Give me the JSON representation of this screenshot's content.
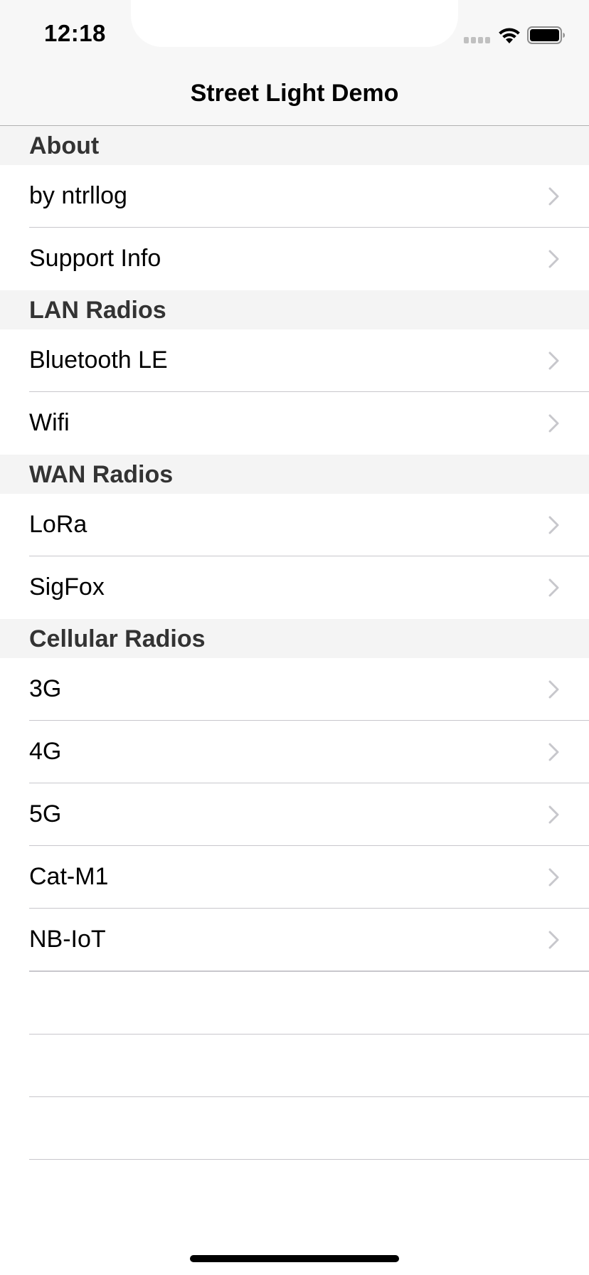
{
  "status_bar": {
    "time": "12:18"
  },
  "nav": {
    "title": "Street Light Demo"
  },
  "sections": [
    {
      "header": "About",
      "rows": [
        {
          "label": "by ntrllog"
        },
        {
          "label": "Support Info"
        }
      ]
    },
    {
      "header": "LAN Radios",
      "rows": [
        {
          "label": "Bluetooth LE"
        },
        {
          "label": "Wifi"
        }
      ]
    },
    {
      "header": "WAN Radios",
      "rows": [
        {
          "label": "LoRa"
        },
        {
          "label": "SigFox"
        }
      ]
    },
    {
      "header": "Cellular Radios",
      "rows": [
        {
          "label": "3G"
        },
        {
          "label": "4G"
        },
        {
          "label": "5G"
        },
        {
          "label": "Cat-M1"
        },
        {
          "label": "NB-IoT"
        }
      ]
    }
  ],
  "icons": {
    "row_accessory": "chevron-right-icon",
    "status": [
      "cellular-signal-icon",
      "wifi-icon",
      "battery-icon"
    ]
  },
  "colors": {
    "bar_background": "#f7f7f7",
    "section_header_background": "#f4f4f4",
    "separator": "#c8c7cc",
    "chevron": "#c7c7cc"
  }
}
